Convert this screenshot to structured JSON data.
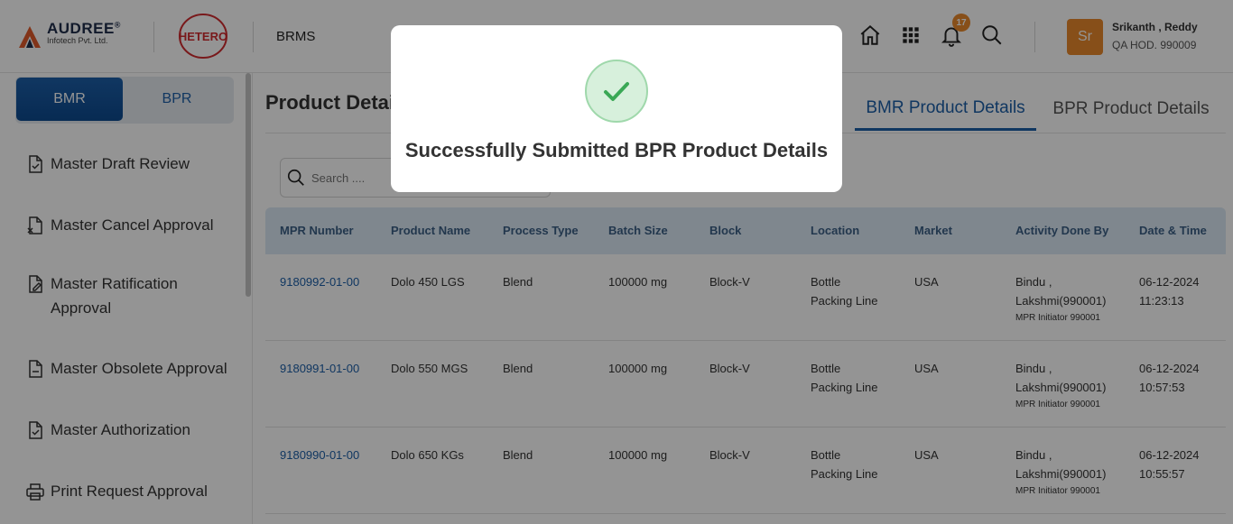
{
  "header": {
    "brand_name": "AUDREE",
    "brand_registered": "®",
    "brand_sub": "Infotech Pvt. Ltd.",
    "partner_logo": "HETERO",
    "app_name": "BRMS",
    "notification_count": "17",
    "user": {
      "initials": "Sr",
      "name": "Srikanth , Reddy",
      "role": "QA HOD. 990009"
    },
    "icons": [
      "home-icon",
      "apps-grid-icon",
      "bell-icon",
      "search-icon"
    ]
  },
  "sidebar": {
    "toggle": {
      "active": "BMR",
      "inactive": "BPR"
    },
    "items": [
      {
        "label": "Master Draft Review",
        "icon": "doc-check-icon"
      },
      {
        "label": "Master Cancel Approval",
        "icon": "doc-cancel-icon"
      },
      {
        "label": "Master Ratification Approval",
        "icon": "doc-edit-icon"
      },
      {
        "label": "Master Obsolete Approval",
        "icon": "doc-minus-icon"
      },
      {
        "label": "Master Authorization",
        "icon": "doc-check-icon"
      },
      {
        "label": "Print Request Approval",
        "icon": "printer-icon"
      }
    ]
  },
  "main": {
    "page_title": "Product Detai",
    "tabs": [
      {
        "label": "BMR Product Details",
        "active": true
      },
      {
        "label": "BPR Product Details",
        "active": false
      }
    ],
    "search_placeholder": "Search ....",
    "columns": [
      "MPR Number",
      "Product Name",
      "Process Type",
      "Batch Size",
      "Block",
      "Location",
      "Market",
      "Activity Done By",
      "Date & Time"
    ],
    "rows": [
      {
        "mpr": "9180992-01-00",
        "product": "Dolo 450 LGS",
        "process": "Blend",
        "batch": "100000 mg",
        "block": "Block-V",
        "loc1": "Bottle",
        "loc2": "Packing Line",
        "market": "USA",
        "by1": "Bindu ,",
        "by2": "Lakshmi(990001)",
        "by3": "MPR Initiator 990001",
        "date": "06-12-2024",
        "time": "11:23:13"
      },
      {
        "mpr": "9180991-01-00",
        "product": "Dolo 550 MGS",
        "process": "Blend",
        "batch": "100000 mg",
        "block": "Block-V",
        "loc1": "Bottle",
        "loc2": "Packing Line",
        "market": "USA",
        "by1": "Bindu ,",
        "by2": "Lakshmi(990001)",
        "by3": "MPR Initiator 990001",
        "date": "06-12-2024",
        "time": "10:57:53"
      },
      {
        "mpr": "9180990-01-00",
        "product": "Dolo 650 KGs",
        "process": "Blend",
        "batch": "100000 mg",
        "block": "Block-V",
        "loc1": "Bottle",
        "loc2": "Packing Line",
        "market": "USA",
        "by1": "Bindu ,",
        "by2": "Lakshmi(990001)",
        "by3": "MPR Initiator 990001",
        "date": "06-12-2024",
        "time": "10:55:57"
      }
    ]
  },
  "modal": {
    "message": "Successfully Submitted BPR Product Details",
    "icon": "check-icon"
  },
  "colors": {
    "accent": "#1d5fa8",
    "brand_orange": "#e8892b",
    "hetero_red": "#d02b2f",
    "success_green": "#3aa856"
  }
}
